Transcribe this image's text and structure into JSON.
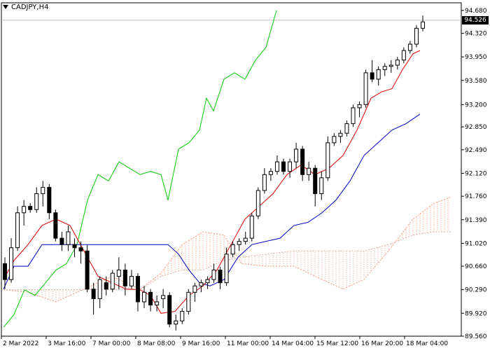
{
  "header": {
    "symbol_label": "CADJPY,H4"
  },
  "current_price": {
    "label": "94.526",
    "value": 94.526
  },
  "colors": {
    "tenkan": "#e00000",
    "kijun": "#0000c8",
    "chikou": "#00cc00",
    "cloud_span_a": "#f4a080",
    "cloud_span_b": "#d9b0a0",
    "candle": "#000000",
    "grid": "#000000"
  },
  "chart_data": {
    "type": "candlestick",
    "indicator": "Ichimoku Kinko Hyo",
    "y_range": [
      89.56,
      94.8
    ],
    "y_ticks": [
      "94.680",
      "94.320",
      "93.950",
      "93.580",
      "93.200",
      "92.850",
      "92.490",
      "92.120",
      "91.760",
      "91.390",
      "91.020",
      "90.660",
      "90.290",
      "89.920",
      "89.560"
    ],
    "x_ticks": [
      "2 Mar 2022",
      "3 Mar 16:00",
      "7 Mar 00:00",
      "8 Mar 08:00",
      "9 Mar 16:00",
      "11 Mar 00:00",
      "14 Mar 04:00",
      "15 Mar 12:00",
      "16 Mar 20:00",
      "18 Mar 04:00"
    ],
    "candles": [
      [
        90.7,
        90.8,
        90.3,
        90.45
      ],
      [
        90.45,
        91.1,
        90.4,
        90.95
      ],
      [
        90.95,
        91.6,
        90.9,
        91.5
      ],
      [
        91.5,
        91.7,
        91.3,
        91.6
      ],
      [
        91.6,
        91.65,
        91.5,
        91.55
      ],
      [
        91.55,
        91.9,
        91.5,
        91.8
      ],
      [
        91.8,
        92.0,
        91.6,
        91.9
      ],
      [
        91.9,
        91.95,
        91.4,
        91.5
      ],
      [
        91.5,
        91.55,
        91.05,
        91.1
      ],
      [
        91.1,
        91.2,
        90.9,
        91.0
      ],
      [
        91.0,
        91.3,
        90.9,
        91.2
      ],
      [
        91.0,
        91.1,
        90.8,
        90.95
      ],
      [
        90.95,
        91.05,
        90.7,
        90.9
      ],
      [
        90.9,
        91.0,
        90.25,
        90.3
      ],
      [
        90.3,
        90.4,
        89.9,
        90.15
      ],
      [
        90.15,
        90.5,
        90.0,
        90.45
      ],
      [
        90.4,
        90.5,
        90.2,
        90.3
      ],
      [
        90.3,
        90.6,
        90.25,
        90.55
      ],
      [
        90.5,
        90.8,
        90.3,
        90.6
      ],
      [
        90.6,
        90.7,
        90.2,
        90.35
      ],
      [
        90.35,
        90.6,
        90.3,
        90.5
      ],
      [
        90.5,
        90.55,
        89.95,
        90.1
      ],
      [
        90.1,
        90.35,
        90.0,
        90.25
      ],
      [
        90.25,
        90.3,
        89.95,
        90.05
      ],
      [
        90.05,
        90.2,
        89.95,
        90.1
      ],
      [
        90.15,
        90.3,
        90.0,
        90.2
      ],
      [
        90.2,
        90.25,
        89.7,
        89.75
      ],
      [
        89.75,
        89.9,
        89.65,
        89.8
      ],
      [
        89.8,
        90.0,
        89.75,
        89.95
      ],
      [
        89.95,
        90.3,
        89.9,
        90.25
      ],
      [
        90.25,
        90.4,
        90.1,
        90.35
      ],
      [
        90.35,
        90.45,
        90.25,
        90.4
      ],
      [
        90.4,
        90.5,
        90.3,
        90.45
      ],
      [
        90.45,
        90.7,
        90.4,
        90.6
      ],
      [
        90.6,
        90.65,
        90.3,
        90.4
      ],
      [
        90.4,
        90.95,
        90.35,
        90.85
      ],
      [
        90.85,
        91.05,
        90.8,
        91.0
      ],
      [
        91.0,
        91.1,
        90.9,
        91.05
      ],
      [
        91.05,
        91.2,
        91.0,
        91.1
      ],
      [
        91.1,
        91.5,
        91.05,
        91.45
      ],
      [
        91.45,
        91.9,
        91.4,
        91.85
      ],
      [
        91.85,
        92.2,
        91.8,
        92.1
      ],
      [
        92.1,
        92.2,
        92.0,
        92.15
      ],
      [
        92.15,
        92.4,
        92.1,
        92.3
      ],
      [
        92.3,
        92.35,
        92.1,
        92.15
      ],
      [
        92.15,
        92.35,
        92.05,
        92.3
      ],
      [
        92.3,
        92.6,
        92.2,
        92.5
      ],
      [
        92.5,
        92.55,
        92.0,
        92.1
      ],
      [
        92.1,
        92.3,
        92.0,
        92.2
      ],
      [
        92.2,
        92.25,
        91.6,
        91.8
      ],
      [
        91.8,
        92.15,
        91.7,
        92.05
      ],
      [
        92.05,
        92.7,
        92.0,
        92.6
      ],
      [
        92.6,
        92.75,
        92.55,
        92.7
      ],
      [
        92.7,
        92.8,
        92.6,
        92.75
      ],
      [
        92.75,
        92.95,
        92.7,
        92.9
      ],
      [
        92.9,
        93.2,
        92.85,
        93.15
      ],
      [
        93.15,
        93.25,
        93.0,
        93.2
      ],
      [
        93.2,
        93.75,
        93.15,
        93.7
      ],
      [
        93.7,
        93.9,
        93.55,
        93.6
      ],
      [
        93.6,
        93.8,
        93.5,
        93.75
      ],
      [
        93.75,
        93.85,
        93.65,
        93.8
      ],
      [
        93.8,
        93.9,
        93.7,
        93.82
      ],
      [
        93.82,
        93.95,
        93.75,
        93.9
      ],
      [
        93.9,
        94.1,
        93.85,
        94.05
      ],
      [
        94.05,
        94.2,
        94.0,
        94.15
      ],
      [
        94.15,
        94.45,
        94.1,
        94.4
      ],
      [
        94.4,
        94.6,
        94.35,
        94.5
      ]
    ]
  }
}
